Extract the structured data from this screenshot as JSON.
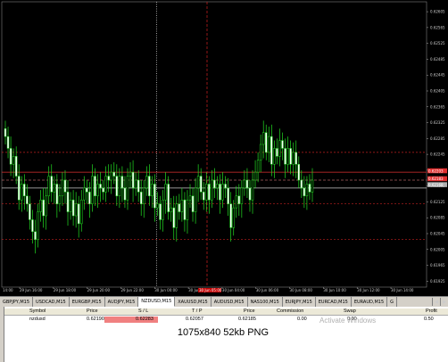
{
  "window": {
    "title": "NZDUSD,M15"
  },
  "chart_data": {
    "type": "candlestick",
    "symbol": "NZDUSD",
    "timeframe": "M15",
    "price_axis_labels": [
      "0.62605",
      "0.62565",
      "0.62525",
      "0.62485",
      "0.62445",
      "0.62405",
      "0.62365",
      "0.62325",
      "0.62285",
      "0.62245",
      "0.62205",
      "0.62165",
      "0.62125",
      "0.62085",
      "0.62045",
      "0.62005",
      "0.61965",
      "0.61925"
    ],
    "price_min": 0.6191,
    "price_max": 0.6263,
    "time_axis_labels": [
      "29 Jun 16:00",
      "29 Jun 18:00",
      "29 Jun 20:00",
      "29 Jun 22:00",
      "30 Jun 00:00",
      "30 Jun 02:00",
      "30 Jun 04:00",
      "30 Jun 06:00",
      "30 Jun 08:00",
      "30 Jun 10:00",
      "30 Jun 12:00",
      "30 Jun 14:00"
    ],
    "time_axis_prefix": "14:00",
    "highlight_time_label": "30 Jun 05:00",
    "closes": [
      0.6229,
      0.6226,
      0.6222,
      0.6224,
      0.6219,
      0.6213,
      0.6217,
      0.6214,
      0.6212,
      0.6208,
      0.6205,
      0.6203,
      0.621,
      0.6213,
      0.6209,
      0.6214,
      0.6219,
      0.6215,
      0.6217,
      0.6212,
      0.6214,
      0.6218,
      0.6215,
      0.621,
      0.6213,
      0.6209,
      0.6212,
      0.6207,
      0.6213,
      0.6216,
      0.6215,
      0.6212,
      0.6219,
      0.6214,
      0.6217,
      0.6216,
      0.6215,
      0.6219,
      0.6218,
      0.622,
      0.6219,
      0.6214,
      0.6219,
      0.6216,
      0.6213,
      0.6219,
      0.622,
      0.6216,
      0.6218,
      0.6215,
      0.6212,
      0.6216,
      0.6219,
      0.6214,
      0.6217,
      0.6211,
      0.6212,
      0.6208,
      0.6213,
      0.6217,
      0.621,
      0.6211,
      0.6206,
      0.6212,
      0.621,
      0.6213,
      0.6208,
      0.6213,
      0.6214,
      0.621,
      0.6216,
      0.6219,
      0.6215,
      0.6213,
      0.6217,
      0.6213,
      0.6218,
      0.6216,
      0.6217,
      0.6213,
      0.6217,
      0.6216,
      0.6212,
      0.6206,
      0.6211,
      0.6214,
      0.6212,
      0.6216,
      0.6218,
      0.6216,
      0.6213,
      0.6218,
      0.622,
      0.6223,
      0.6227,
      0.623,
      0.6225,
      0.6229,
      0.6222,
      0.6226,
      0.6224,
      0.6228,
      0.6226,
      0.6222,
      0.6226,
      0.6222,
      0.6225,
      0.6222,
      0.6218,
      0.6216,
      0.6214,
      0.6217,
      0.6215,
      0.6218
    ],
    "lines": {
      "horizontal_red_dotted": [
        0.6225,
        0.6212,
        0.6203
      ],
      "horizontal_red_solid": [
        0.622
      ],
      "horizontal_pink": [
        0.6218
      ],
      "horizontal_gray": [
        0.6216
      ],
      "vertical_dotted_white_at": "29 Jun 22:00",
      "vertical_red_dashed_at": "30 Jun 05:00"
    },
    "price_tags": [
      {
        "value": "0.62203",
        "color": "#e03030"
      },
      {
        "value": "0.62183",
        "color": "#e03030"
      },
      {
        "value": "0.62168",
        "color": "#b0b0b0"
      }
    ]
  },
  "tabs": [
    "GBPJPY,M15",
    "USDCAD,M15",
    "EURGBP,M15",
    "AUDJPY,M15",
    "NZDUSD,M15",
    "XAUUSD,M15",
    "AUDUSD,M15",
    "NAS100,M15",
    "EURJPY,M15",
    "EURCAD,M15",
    "EURAUD,M15",
    "G"
  ],
  "active_tab_index": 4,
  "terminal": {
    "headers": {
      "symbol": "Symbol",
      "price": "Price",
      "sl": "S / L",
      "tp": "T / P",
      "price2": "Price",
      "commission": "Commission",
      "swap": "Swap",
      "profit": "Profit"
    },
    "row": {
      "symbol": "nzdusd",
      "price": "0.62190",
      "sl": "0.62283",
      "tp": "0.62057",
      "price2": "0.62185",
      "commission": "0.00",
      "swap": "0.00",
      "profit": "0.50"
    }
  },
  "watermark": "Activate Windows",
  "info_bar": "1075x840  52kb  PNG"
}
